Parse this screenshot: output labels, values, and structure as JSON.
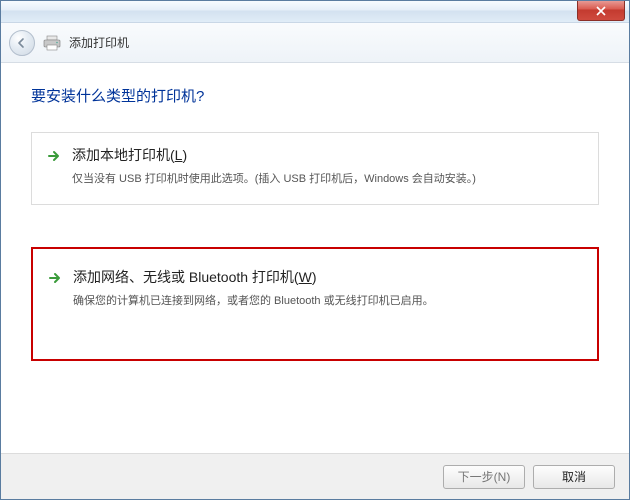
{
  "window": {
    "title": "添加打印机"
  },
  "heading": "要安装什么类型的打印机?",
  "options": [
    {
      "title_pre": "添加本地打印机(",
      "title_key": "L",
      "title_post": ")",
      "desc": "仅当没有 USB 打印机时使用此选项。(插入 USB 打印机后，Windows 会自动安装。)"
    },
    {
      "title_pre": "添加网络、无线或 Bluetooth 打印机(",
      "title_key": "W",
      "title_post": ")",
      "desc": "确保您的计算机已连接到网络，或者您的 Bluetooth 或无线打印机已启用。"
    }
  ],
  "footer": {
    "next": "下一步(N)",
    "cancel": "取消"
  }
}
